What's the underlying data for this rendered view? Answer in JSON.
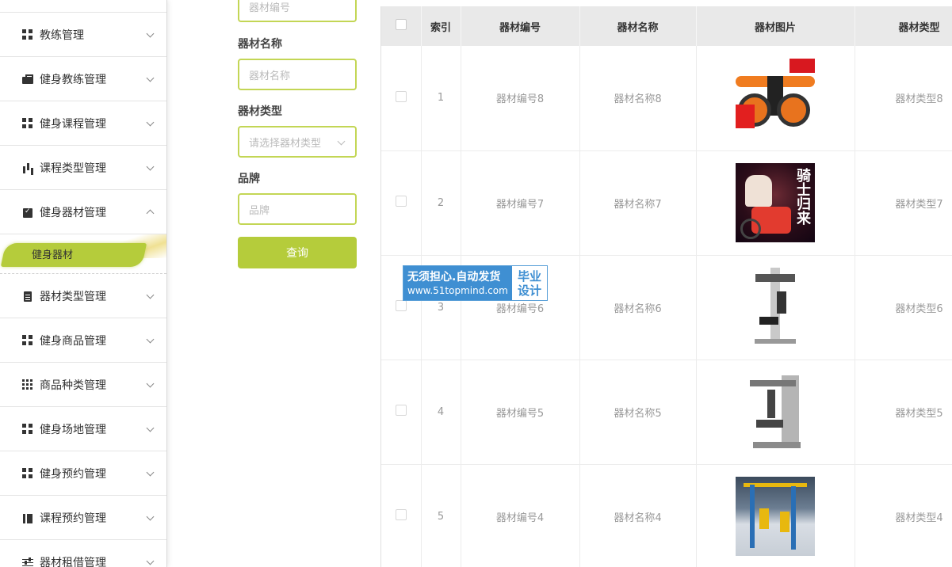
{
  "sidebar": {
    "items": [
      {
        "label": "教练管理",
        "icon": "grid-icon",
        "expanded": false
      },
      {
        "label": "健身教练管理",
        "icon": "briefcase-icon",
        "expanded": false
      },
      {
        "label": "健身课程管理",
        "icon": "grid-icon",
        "expanded": false
      },
      {
        "label": "课程类型管理",
        "icon": "bar-chart-icon",
        "expanded": false
      },
      {
        "label": "健身器材管理",
        "icon": "clipboard-check-icon",
        "expanded": true
      }
    ],
    "active_sub": "健身器材",
    "items_after": [
      {
        "label": "器材类型管理",
        "icon": "document-icon"
      },
      {
        "label": "健身商品管理",
        "icon": "grid-icon"
      },
      {
        "label": "商品种类管理",
        "icon": "grid-9-icon"
      },
      {
        "label": "健身场地管理",
        "icon": "grid-icon"
      },
      {
        "label": "健身预约管理",
        "icon": "grid-icon"
      },
      {
        "label": "课程预约管理",
        "icon": "book-icon"
      },
      {
        "label": "器材租借管理",
        "icon": "sliders-icon"
      }
    ]
  },
  "search": {
    "code_placeholder": "器材编号",
    "name_label": "器材名称",
    "name_placeholder": "器材名称",
    "type_label": "器材类型",
    "type_placeholder": "请选择器材类型",
    "brand_label": "品牌",
    "brand_placeholder": "品牌",
    "query_button": "查询"
  },
  "watermark": {
    "main": "无须担心.自动发货",
    "url": "www.51topmind.com",
    "side_line1": "毕业",
    "side_line2": "设计"
  },
  "table": {
    "headers": [
      "索引",
      "器材编号",
      "器材名称",
      "器材图片",
      "器材类型"
    ],
    "rows": [
      {
        "index": "1",
        "code": "器材编号8",
        "name": "器材名称8",
        "image": "ab-roller",
        "type": "器材类型8"
      },
      {
        "index": "2",
        "code": "器材编号7",
        "name": "器材名称7",
        "image": "spin-bike",
        "type": "器材类型7"
      },
      {
        "index": "3",
        "code": "器材编号6",
        "name": "器材名称6",
        "image": "pec-machine",
        "type": "器材类型6"
      },
      {
        "index": "4",
        "code": "器材编号5",
        "name": "器材名称5",
        "image": "pec-deck",
        "type": "器材类型5"
      },
      {
        "index": "5",
        "code": "器材编号4",
        "name": "器材名称4",
        "image": "outdoor-equipment",
        "type": "器材类型4"
      }
    ],
    "image_text_row2": "骑士归来"
  },
  "colors": {
    "accent": "#b5cc3b",
    "input_border": "#c3d655",
    "header_bg": "#e9e9e9",
    "watermark_blue": "#3f8fd2"
  }
}
